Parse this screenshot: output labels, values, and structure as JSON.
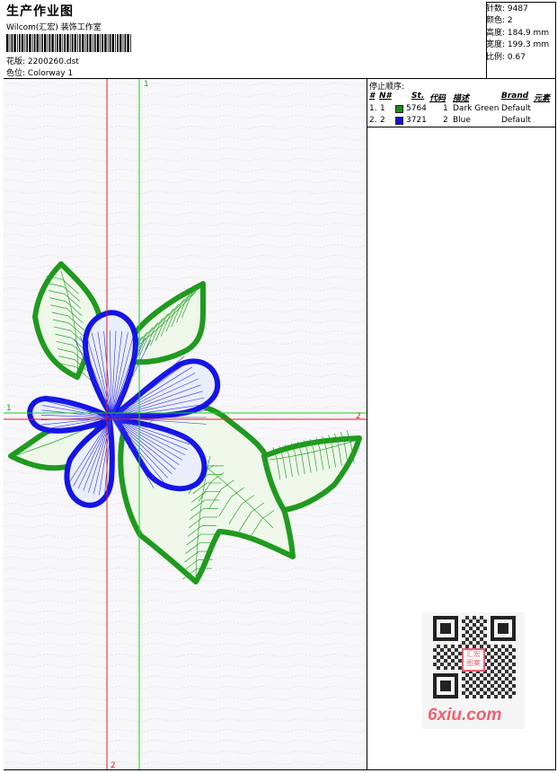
{
  "header": {
    "title": "生产作业图",
    "studio": "Wilcom(汇宏) 装饰工作室",
    "design_label": "花版:",
    "design_file": "2200260.dst",
    "colorway_label": "色位:",
    "colorway": "Colorway 1"
  },
  "stats": [
    {
      "label": "针数:",
      "value": "9487"
    },
    {
      "label": "颜色:",
      "value": "2"
    },
    {
      "label": "高度:",
      "value": "184.9 mm"
    },
    {
      "label": "宽度:",
      "value": "199.3 mm"
    },
    {
      "label": "比例:",
      "value": "0.67"
    }
  ],
  "stop_sequence": {
    "caption": "停止顺序:",
    "headers": {
      "num": "#",
      "no": "N#",
      "st": "St.",
      "code": "代码",
      "desc": "描述",
      "brand": "Brand",
      "element": "元素"
    },
    "rows": [
      {
        "num": "1.",
        "no": "1",
        "st": "5764",
        "code": "1",
        "desc": "Dark Green",
        "brand": "Default",
        "color": "#1a8a1a"
      },
      {
        "num": "2.",
        "no": "2",
        "st": "3721",
        "code": "2",
        "desc": "Blue",
        "brand": "Default",
        "color": "#1010e0"
      }
    ]
  },
  "guides": {
    "green_vertical_label": "1",
    "green_horizontal_label": "1",
    "red_horizontal_label": "2",
    "red_vertical_label": "2"
  },
  "colors": {
    "green": "#1f9a1f",
    "blue": "#1414e6",
    "red_guide": "#e02020",
    "green_guide": "#22cc22"
  },
  "watermark": {
    "logo": "6xiu.com",
    "badge": "汇宏图案"
  }
}
